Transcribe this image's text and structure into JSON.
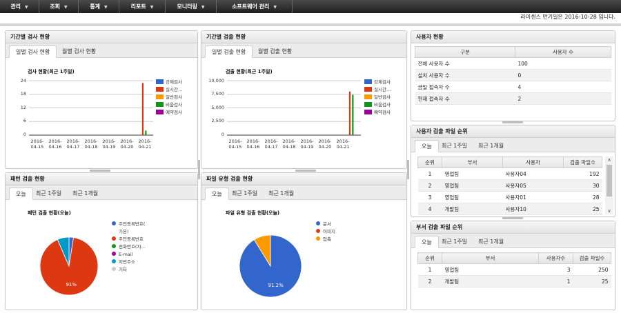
{
  "nav": [
    {
      "label": "관리"
    },
    {
      "label": "조회"
    },
    {
      "label": "통계"
    },
    {
      "label": "리포트"
    },
    {
      "label": "모니터링"
    },
    {
      "label": "소프트웨어 관리"
    }
  ],
  "license_text": "라이센스 만기일은 2016-10-28 입니다.",
  "period_inspect": {
    "title": "기간별 검사 현황",
    "tabs": [
      "일별 검사 현황",
      "월별 검사 현황"
    ]
  },
  "period_detect": {
    "title": "기간별 검출 현황",
    "tabs": [
      "일별 검출 현황",
      "월별 검출 현황"
    ]
  },
  "pattern_detect": {
    "title": "패턴 검출 현황",
    "tabs": [
      "오늘",
      "최근 1주일",
      "최근 1개월"
    ]
  },
  "filetype_detect": {
    "title": "파일 유형 검출 현황",
    "tabs": [
      "오늘",
      "최근 1주일",
      "최근 1개월"
    ]
  },
  "user_status": {
    "title": "사용자 현황",
    "headers": [
      "구분",
      "사용자 수"
    ],
    "rows": [
      [
        "전체 사용자 수",
        "100"
      ],
      [
        "설치 사용자 수",
        "0"
      ],
      [
        "금일 접속자 수",
        "4"
      ],
      [
        "현재 접속자 수",
        "2"
      ]
    ]
  },
  "user_rank": {
    "title": "사용자 검출 파일 순위",
    "tabs": [
      "오늘",
      "최근 1주일",
      "최근 1개월"
    ],
    "headers": [
      "순위",
      "부서",
      "사용자",
      "검출 파일수"
    ],
    "rows": [
      [
        "1",
        "영업팀",
        "사용자04",
        "192"
      ],
      [
        "2",
        "영업팀",
        "사용자05",
        "30"
      ],
      [
        "3",
        "영업팀",
        "사용자01",
        "28"
      ],
      [
        "4",
        "개발팀",
        "사용자10",
        "25"
      ]
    ],
    "scroll_up": "∧",
    "scroll_down": "∨"
  },
  "dept_rank": {
    "title": "부서 검출 파일 순위",
    "tabs": [
      "오늘",
      "최근 1주일",
      "최근 1개월"
    ],
    "headers": [
      "순위",
      "부서",
      "사용자수",
      "검출 파일수"
    ],
    "rows": [
      [
        "1",
        "영업팀",
        "3",
        "250"
      ],
      [
        "2",
        "개발팀",
        "1",
        "25"
      ]
    ]
  },
  "chart_data": [
    {
      "type": "bar",
      "title": "검사 현황(최근 1주일)",
      "categories": [
        "2016-04-15",
        "2016-04-16",
        "2016-04-17",
        "2016-04-18",
        "2016-04-19",
        "2016-04-20",
        "2016-04-21"
      ],
      "x_tick_lines": [
        [
          "2016-",
          "04-15"
        ],
        [
          "2016-",
          "04-16"
        ],
        [
          "2016-",
          "04-17"
        ],
        [
          "2016-",
          "04-18"
        ],
        [
          "2016-",
          "04-19"
        ],
        [
          "2016-",
          "04-20"
        ],
        [
          "2016-",
          "04-21"
        ]
      ],
      "y_ticks": [
        "24",
        "18",
        "12",
        "6",
        "0"
      ],
      "ylim": [
        0,
        24
      ],
      "legend_labels": [
        "강제검사",
        "실시간…",
        "일반검사",
        "비움검사",
        "예약검사"
      ],
      "series": [
        {
          "name": "강제검사",
          "color": "#3366cc",
          "values": [
            0,
            0,
            0,
            0,
            0,
            0,
            0
          ]
        },
        {
          "name": "실시간…",
          "color": "#dc3912",
          "values": [
            0,
            0,
            0,
            0,
            0,
            0,
            23
          ]
        },
        {
          "name": "일반검사",
          "color": "#ff9900",
          "values": [
            0,
            0,
            0,
            0,
            0,
            0,
            0
          ]
        },
        {
          "name": "비움검사",
          "color": "#109618",
          "values": [
            0,
            0,
            0,
            0,
            0,
            0,
            2
          ]
        },
        {
          "name": "예약검사",
          "color": "#990099",
          "values": [
            0,
            0,
            0,
            0,
            0,
            0,
            0
          ]
        }
      ]
    },
    {
      "type": "bar",
      "title": "검출 현황(최근 1주일)",
      "categories": [
        "2016-04-15",
        "2016-04-16",
        "2016-04-17",
        "2016-04-18",
        "2016-04-19",
        "2016-04-20",
        "2016-04-21"
      ],
      "x_tick_lines": [
        [
          "2016-",
          "04-15"
        ],
        [
          "2016-",
          "04-16"
        ],
        [
          "2016-",
          "04-17"
        ],
        [
          "2016-",
          "04-18"
        ],
        [
          "2016-",
          "04-19"
        ],
        [
          "2016-",
          "04-20"
        ],
        [
          "2016-",
          "04-21"
        ]
      ],
      "y_ticks": [
        "10,000",
        "7,500",
        "5,000",
        "2,500",
        "0"
      ],
      "ylim": [
        0,
        10000
      ],
      "legend_labels": [
        "강제검사",
        "실시간…",
        "일반검사",
        "비움검사",
        "예약검사"
      ],
      "series": [
        {
          "name": "강제검사",
          "color": "#3366cc",
          "values": [
            0,
            0,
            0,
            0,
            0,
            0,
            0
          ]
        },
        {
          "name": "실시간…",
          "color": "#dc3912",
          "values": [
            0,
            0,
            0,
            0,
            0,
            0,
            8000
          ]
        },
        {
          "name": "일반검사",
          "color": "#ff9900",
          "values": [
            0,
            0,
            0,
            0,
            0,
            0,
            0
          ]
        },
        {
          "name": "비움검사",
          "color": "#109618",
          "values": [
            0,
            0,
            0,
            0,
            0,
            0,
            7400
          ]
        },
        {
          "name": "예약검사",
          "color": "#990099",
          "values": [
            0,
            0,
            0,
            0,
            0,
            0,
            0
          ]
        }
      ]
    },
    {
      "type": "pie",
      "title": "패턴 검출 현황(오늘)",
      "legend": [
        {
          "label": "주민등록번호(",
          "label2": "기본)",
          "color": "#3366cc"
        },
        {
          "label": "주민등록번호",
          "color": "#dc3912"
        },
        {
          "label": "전화번호(지…",
          "color": "#109618"
        },
        {
          "label": "E-mail",
          "color": "#990099"
        },
        {
          "label": "지번주소",
          "color": "#0099c6"
        },
        {
          "label": "기타",
          "color": "#cccccc"
        }
      ],
      "slices": [
        {
          "name": "주민등록번호(기본)",
          "value": 2.5,
          "color": "#3366cc"
        },
        {
          "name": "주민등록번호",
          "value": 91,
          "color": "#dc3912",
          "label": "91%"
        },
        {
          "name": "지번주소",
          "value": 6.5,
          "color": "#0099c6"
        }
      ]
    },
    {
      "type": "pie",
      "title": "파일 유형 검출 현황(오늘)",
      "legend": [
        {
          "label": "문서",
          "color": "#3366cc"
        },
        {
          "label": "이미지",
          "color": "#dc3912"
        },
        {
          "label": "압축",
          "color": "#ff9900"
        }
      ],
      "slices": [
        {
          "name": "문서",
          "value": 91.2,
          "color": "#3366cc",
          "label": "91.2%"
        },
        {
          "name": "압축",
          "value": 8.8,
          "color": "#ff9900"
        }
      ]
    }
  ]
}
